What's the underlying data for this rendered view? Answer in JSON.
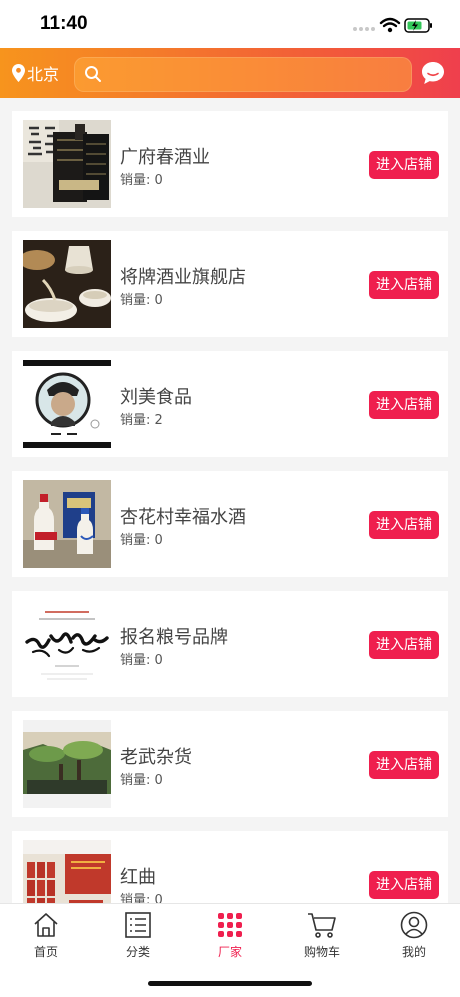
{
  "status": {
    "time": "11:40"
  },
  "header": {
    "location": "北京",
    "search_placeholder": ""
  },
  "stores": [
    {
      "name": "广府春酒业",
      "sales_label": "销量:",
      "sales": "0",
      "button": "进入店铺",
      "thumb": "liquor-bottle-box"
    },
    {
      "name": "将牌酒业旗舰店",
      "sales_label": "销量:",
      "sales": "0",
      "button": "进入店铺",
      "thumb": "wine-cups"
    },
    {
      "name": "刘美食品",
      "sales_label": "销量:",
      "sales": "2",
      "button": "进入店铺",
      "thumb": "portrait-logo"
    },
    {
      "name": "杏花村幸福水酒",
      "sales_label": "销量:",
      "sales": "0",
      "button": "进入店铺",
      "thumb": "bottles-gift-box"
    },
    {
      "name": "报名粮号品牌",
      "sales_label": "销量:",
      "sales": "0",
      "button": "进入店铺",
      "thumb": "calligraphy-brand"
    },
    {
      "name": "老武杂货",
      "sales_label": "销量:",
      "sales": "0",
      "button": "进入店铺",
      "thumb": "garden-interior"
    },
    {
      "name": "红曲",
      "sales_label": "销量:",
      "sales": "0",
      "button": "进入店铺",
      "thumb": "red-product-boxes"
    }
  ],
  "tabbar": [
    {
      "label": "首页",
      "icon": "home-icon",
      "active": false
    },
    {
      "label": "分类",
      "icon": "list-icon",
      "active": false
    },
    {
      "label": "厂家",
      "icon": "grid-icon",
      "active": true
    },
    {
      "label": "购物车",
      "icon": "cart-icon",
      "active": false
    },
    {
      "label": "我的",
      "icon": "user-icon",
      "active": false
    }
  ],
  "colors": {
    "accent": "#ef1f4e",
    "header_start": "#f7941d",
    "header_end": "#ef3f4d"
  }
}
